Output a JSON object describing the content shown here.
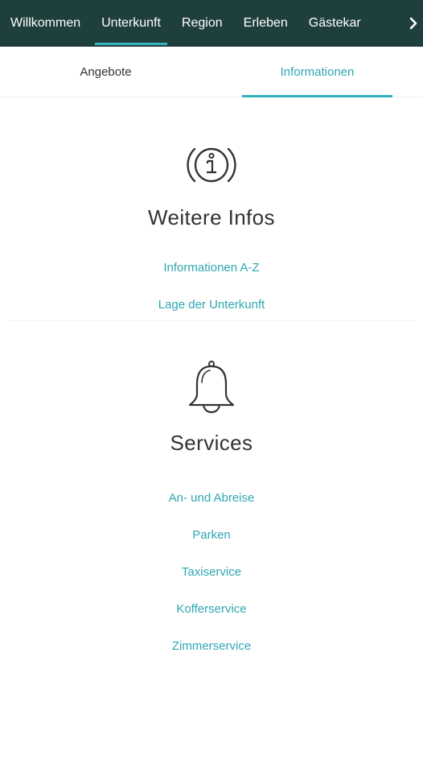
{
  "topnav": {
    "items": [
      "Willkommen",
      "Unterkunft",
      "Region",
      "Erleben",
      "Gästekar"
    ],
    "active_index": 1
  },
  "subtabs": {
    "items": [
      "Angebote",
      "Informationen"
    ],
    "active_index": 1
  },
  "sections": [
    {
      "title": "Weitere Infos",
      "icon": "info-icon",
      "links": [
        "Informationen A-Z",
        "Lage der Unterkunft"
      ]
    },
    {
      "title": "Services",
      "icon": "bell-icon",
      "links": [
        "An- und Abreise",
        "Parken",
        "Taxiservice",
        "Kofferservice",
        "Zimmerservice"
      ]
    }
  ],
  "colors": {
    "nav_background": "#1f3f3d",
    "accent": "#33b2bd",
    "link": "#2fa7b2"
  }
}
